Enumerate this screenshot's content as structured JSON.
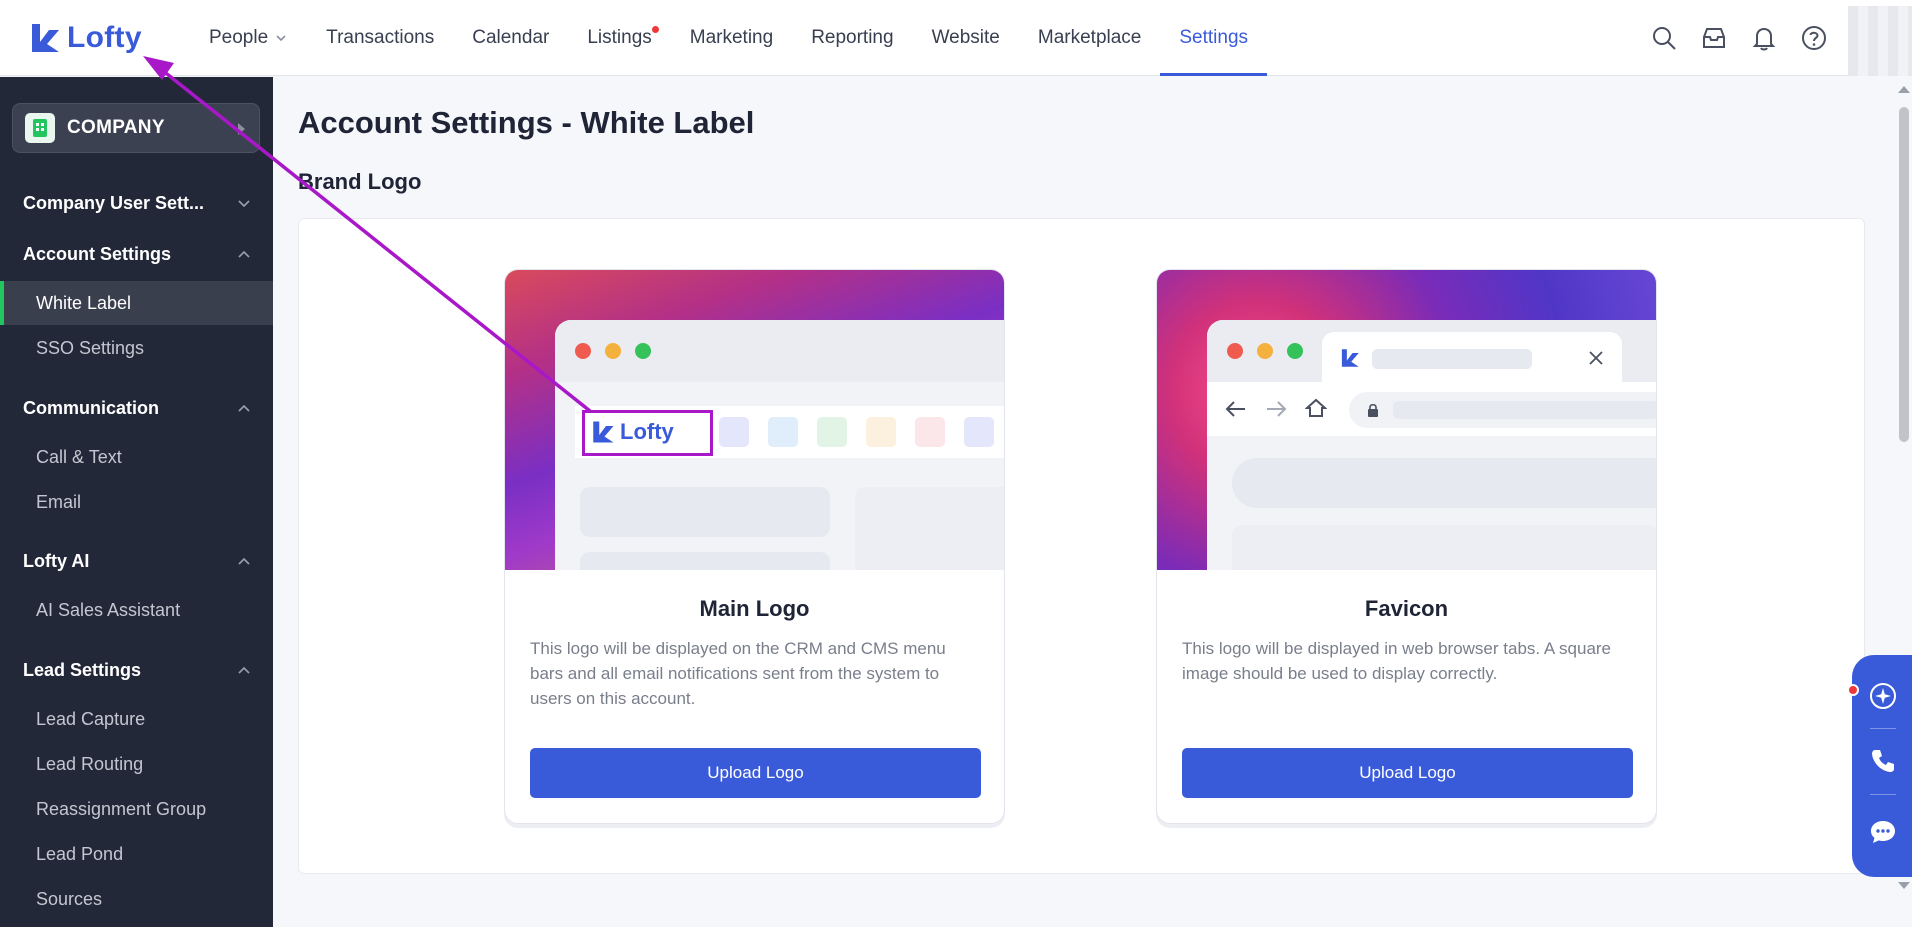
{
  "app": {
    "brand_name": "Lofty",
    "accent_color": "#3a5bd9"
  },
  "nav": {
    "items": [
      {
        "label": "People",
        "has_dropdown": true
      },
      {
        "label": "Transactions"
      },
      {
        "label": "Calendar"
      },
      {
        "label": "Listings",
        "has_notification_dot": true
      },
      {
        "label": "Marketing"
      },
      {
        "label": "Reporting"
      },
      {
        "label": "Website"
      },
      {
        "label": "Marketplace"
      },
      {
        "label": "Settings",
        "active": true
      }
    ],
    "icons": [
      "search-icon",
      "inbox-icon",
      "bell-icon",
      "help-icon"
    ]
  },
  "sidebar": {
    "company_label": "COMPANY",
    "groups": [
      {
        "label": "Company User Sett...",
        "expanded": false,
        "items": []
      },
      {
        "label": "Account Settings",
        "expanded": true,
        "items": [
          {
            "label": "White Label",
            "active": true
          },
          {
            "label": "SSO Settings"
          }
        ]
      },
      {
        "label": "Communication",
        "expanded": true,
        "items": [
          {
            "label": "Call & Text"
          },
          {
            "label": "Email"
          }
        ]
      },
      {
        "label": "Lofty AI",
        "expanded": true,
        "items": [
          {
            "label": "AI Sales Assistant"
          }
        ]
      },
      {
        "label": "Lead Settings",
        "expanded": true,
        "items": [
          {
            "label": "Lead Capture"
          },
          {
            "label": "Lead Routing"
          },
          {
            "label": "Reassignment Group"
          },
          {
            "label": "Lead Pond"
          },
          {
            "label": "Sources"
          }
        ]
      }
    ]
  },
  "main": {
    "page_title": "Account Settings - White Label",
    "section_title": "Brand Logo",
    "cards": [
      {
        "title": "Main Logo",
        "description": "This logo will be displayed on the CRM and CMS menu bars and all email notifications sent from the system to users on this account.",
        "button_label": "Upload Logo",
        "preview_logo_text": "Lofty"
      },
      {
        "title": "Favicon",
        "description": "This logo will be displayed in web browser tabs. A square image should be used to display correctly.",
        "button_label": "Upload Logo"
      }
    ]
  },
  "floating_actions": [
    "ai-assistant-icon",
    "phone-icon",
    "chat-icon"
  ],
  "annotation": {
    "color": "#a818c9"
  }
}
